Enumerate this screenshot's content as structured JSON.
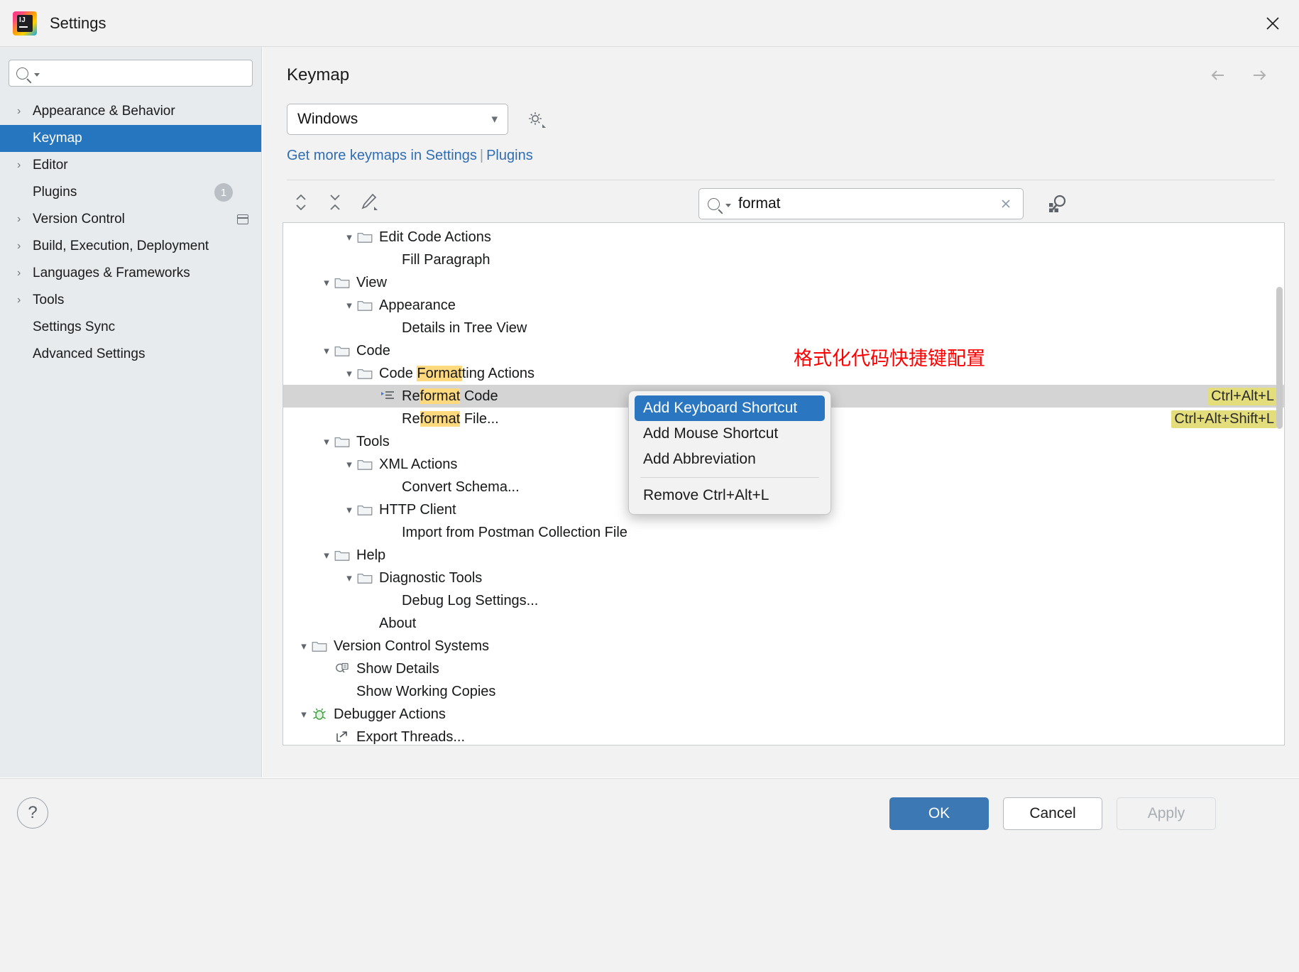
{
  "window": {
    "title": "Settings",
    "app_icon": "intellij-idea-logo",
    "close_icon": "close-icon"
  },
  "sidebar": {
    "search": {
      "placeholder": "",
      "value": "",
      "icon": "search-icon"
    },
    "items": [
      {
        "label": "Appearance & Behavior",
        "expandable": true,
        "selected": false
      },
      {
        "label": "Keymap",
        "expandable": false,
        "selected": true
      },
      {
        "label": "Editor",
        "expandable": true,
        "selected": false
      },
      {
        "label": "Plugins",
        "expandable": false,
        "selected": false,
        "badge": "1"
      },
      {
        "label": "Version Control",
        "expandable": true,
        "selected": false,
        "trailing_icon": "panel-icon"
      },
      {
        "label": "Build, Execution, Deployment",
        "expandable": true,
        "selected": false
      },
      {
        "label": "Languages & Frameworks",
        "expandable": true,
        "selected": false
      },
      {
        "label": "Tools",
        "expandable": true,
        "selected": false
      },
      {
        "label": "Settings Sync",
        "expandable": false,
        "selected": false
      },
      {
        "label": "Advanced Settings",
        "expandable": false,
        "selected": false
      }
    ]
  },
  "main": {
    "page_title": "Keymap",
    "nav": {
      "back_icon": "arrow-left-icon",
      "forward_icon": "arrow-right-icon"
    },
    "keymap_select": {
      "value": "Windows",
      "chevron_icon": "chevron-down-icon"
    },
    "gear_icon": "gear-icon",
    "links": {
      "text": "Get more keymaps in Settings",
      "separator": "|",
      "plugins": "Plugins"
    },
    "toolbar": {
      "expand_all_icon": "expand-all-icon",
      "collapse_all_icon": "collapse-all-icon",
      "edit_icon": "pencil-edit-icon"
    },
    "tree_search": {
      "value": "format",
      "icon": "search-icon",
      "clear_icon": "close-icon"
    },
    "find_by_shortcut_icon": "find-by-shortcut-icon",
    "annotation": "格式化代码快捷键配置"
  },
  "tree": [
    {
      "label": "Edit Code Actions",
      "indent": 2,
      "chevron": "v",
      "icon": "folder",
      "hl": ""
    },
    {
      "label": "Fill Paragraph",
      "indent": 3,
      "chevron": "",
      "icon": "none",
      "hl": ""
    },
    {
      "label": "View",
      "indent": 1,
      "chevron": "v",
      "icon": "folder",
      "hl": ""
    },
    {
      "label": "Appearance",
      "indent": 2,
      "chevron": "v",
      "icon": "folder",
      "hl": ""
    },
    {
      "label": "Details in Tree View",
      "indent": 3,
      "chevron": "",
      "icon": "none",
      "hl": ""
    },
    {
      "label": "Code",
      "indent": 1,
      "chevron": "v",
      "icon": "folder",
      "hl": ""
    },
    {
      "label": "Code Formatting Actions",
      "indent": 2,
      "chevron": "v",
      "icon": "folder",
      "hl": "Format"
    },
    {
      "label": "Reformat Code",
      "indent": 3,
      "chevron": "",
      "icon": "reformat",
      "hl": "format",
      "selected": true,
      "shortcut": "Ctrl+Alt+L"
    },
    {
      "label": "Reformat File...",
      "indent": 3,
      "chevron": "",
      "icon": "none",
      "hl": "format",
      "shortcut": "Ctrl+Alt+Shift+L"
    },
    {
      "label": "Tools",
      "indent": 1,
      "chevron": "v",
      "icon": "folder",
      "hl": ""
    },
    {
      "label": "XML Actions",
      "indent": 2,
      "chevron": "v",
      "icon": "folder",
      "hl": ""
    },
    {
      "label": "Convert Schema...",
      "indent": 3,
      "chevron": "",
      "icon": "none",
      "hl": ""
    },
    {
      "label": "HTTP Client",
      "indent": 2,
      "chevron": "v",
      "icon": "folder",
      "hl": ""
    },
    {
      "label": "Import from Postman Collection File",
      "indent": 3,
      "chevron": "",
      "icon": "none",
      "hl": ""
    },
    {
      "label": "Help",
      "indent": 1,
      "chevron": "v",
      "icon": "folder",
      "hl": ""
    },
    {
      "label": "Diagnostic Tools",
      "indent": 2,
      "chevron": "v",
      "icon": "folder",
      "hl": ""
    },
    {
      "label": "Debug Log Settings...",
      "indent": 3,
      "chevron": "",
      "icon": "none",
      "hl": ""
    },
    {
      "label": "About",
      "indent": 2,
      "chevron": "",
      "icon": "none",
      "hl": ""
    },
    {
      "label": "Version Control Systems",
      "indent": 0,
      "chevron": "v",
      "icon": "folder",
      "hl": ""
    },
    {
      "label": "Show Details",
      "indent": 1,
      "chevron": "",
      "icon": "details",
      "hl": ""
    },
    {
      "label": "Show Working Copies",
      "indent": 1,
      "chevron": "",
      "icon": "none",
      "hl": ""
    },
    {
      "label": "Debugger Actions",
      "indent": 0,
      "chevron": "v",
      "icon": "bug",
      "hl": ""
    },
    {
      "label": "Export Threads...",
      "indent": 1,
      "chevron": "",
      "icon": "export",
      "hl": ""
    }
  ],
  "context_menu": {
    "items": [
      {
        "label": "Add Keyboard Shortcut",
        "active": true
      },
      {
        "label": "Add Mouse Shortcut",
        "active": false
      },
      {
        "label": "Add Abbreviation",
        "active": false
      },
      {
        "label": "Remove Ctrl+Alt+L",
        "active": false,
        "after_separator": true
      }
    ]
  },
  "footer": {
    "help_label": "?",
    "ok_label": "OK",
    "cancel_label": "Cancel",
    "apply_label": "Apply"
  },
  "colors": {
    "accent": "#2675bf",
    "ok_button": "#3c78b4",
    "highlight": "#ffd97d",
    "shortcut_bg": "#e4dd7b",
    "annotation": "#ff0000"
  }
}
